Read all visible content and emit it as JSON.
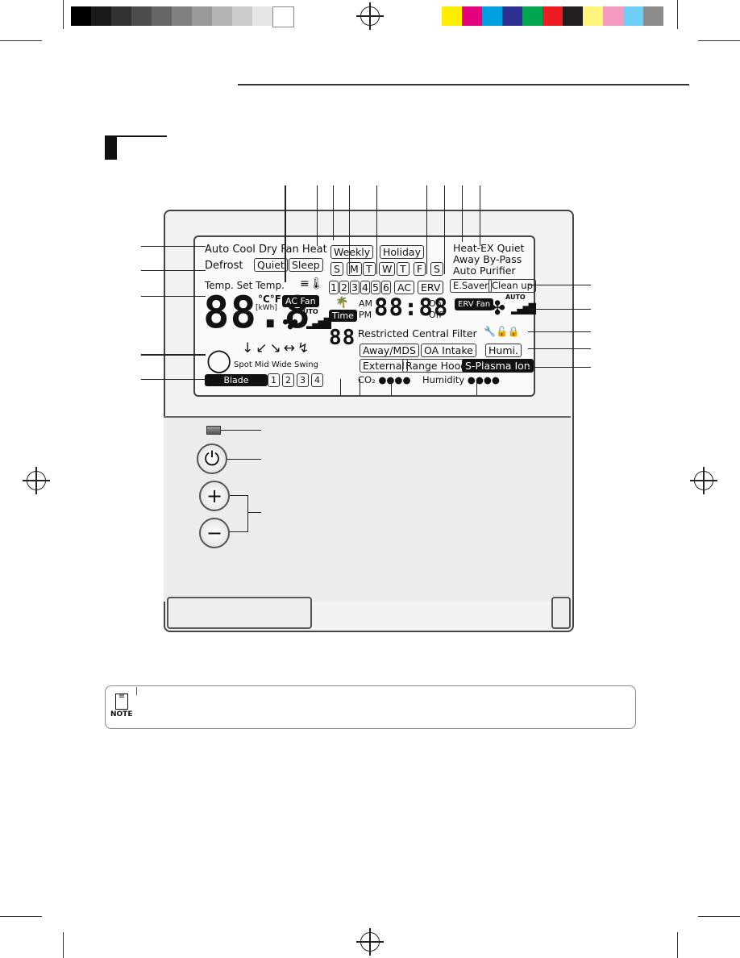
{
  "lcd": {
    "modes": "Auto Cool Dry Fan Heat",
    "defrost": "Defrost",
    "quiet": "Quiet",
    "sleep": "Sleep",
    "weekly": "Weekly",
    "holiday": "Holiday",
    "days": [
      "S",
      "M",
      "T",
      "W",
      "T",
      "F",
      "S"
    ],
    "programs": [
      "1",
      "2",
      "3",
      "4",
      "5",
      "6"
    ],
    "ac": "AC",
    "erv": "ERV",
    "erv_modes_1": "Heat-EX  Quiet",
    "erv_modes_2": "Away  By-Pass",
    "erv_modes_3": "Auto  Purifier",
    "esaver": "E.Saver",
    "cleanup": "Clean up",
    "temp_label": "Temp. Set Temp.",
    "temp_digits": "88.8",
    "unit": "°C°F",
    "kwh": "[kWh]",
    "ac_fan": "AC Fan",
    "auto": "AUTO",
    "erv_fan": "ERV Fan",
    "time_badge": "Time",
    "am": "AM",
    "pm": "PM",
    "clock": "88:88",
    "on": "On",
    "off": "Off",
    "code_digits": "88",
    "restricted": "Restricted Central Filter",
    "away_mds": "Away/MDS",
    "oa_intake": "OA Intake",
    "humi": "Humi.",
    "external": "External",
    "range_hood": "Range Hood",
    "splasma": "S-Plasma Ion",
    "co2": "CO₂ ●●●●",
    "humidity": "Humidity ●●●●",
    "swing_labels": "Spot  Mid   Wide  Swing",
    "blade": "Blade",
    "blades": [
      "1",
      "2",
      "3",
      "4"
    ],
    "blade_nums": [
      "1",
      "2",
      "3"
    ]
  },
  "note": {
    "label": "NOTE"
  }
}
